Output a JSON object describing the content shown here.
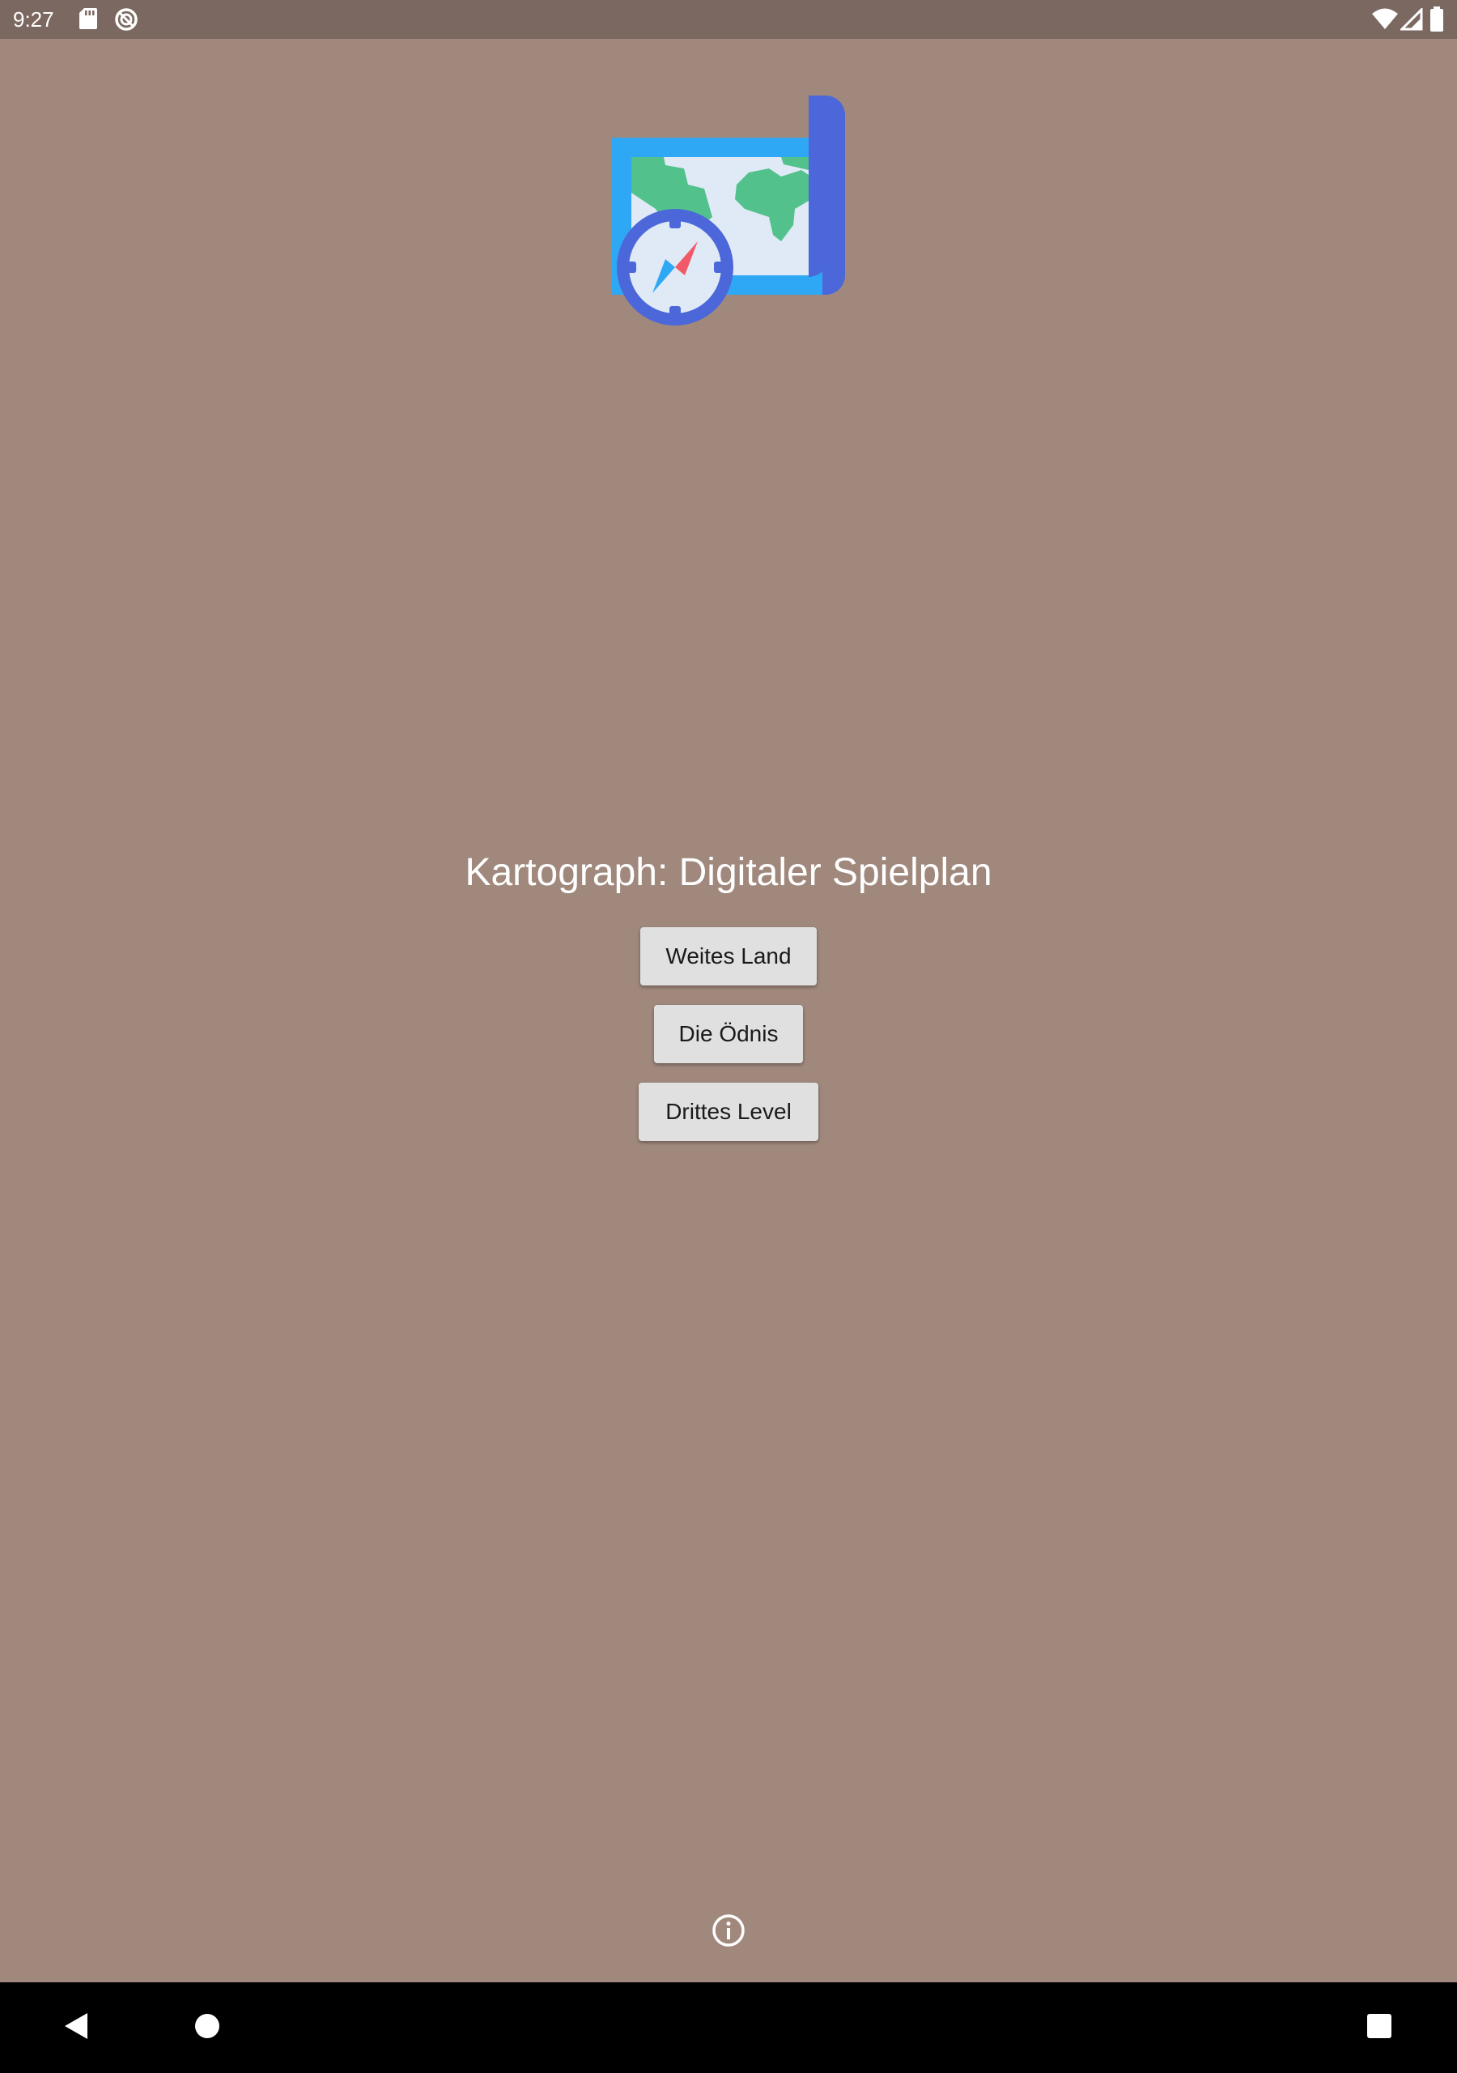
{
  "status_bar": {
    "time": "9:27",
    "left_icons": [
      "sd-card-icon",
      "data-saver-icon"
    ],
    "right_icons": [
      "wifi-icon",
      "cell-signal-icon",
      "battery-icon"
    ]
  },
  "app": {
    "background_color": "#a0887d",
    "logo": "map-compass-icon",
    "title": "Kartograph: Digitaler Spielplan",
    "buttons": [
      {
        "label": "Weites Land"
      },
      {
        "label": "Die Ödnis"
      },
      {
        "label": "Drittes Level"
      }
    ],
    "info_icon": "info-icon"
  },
  "nav_bar": {
    "items": [
      "back-icon",
      "home-icon",
      "recents-icon"
    ]
  }
}
